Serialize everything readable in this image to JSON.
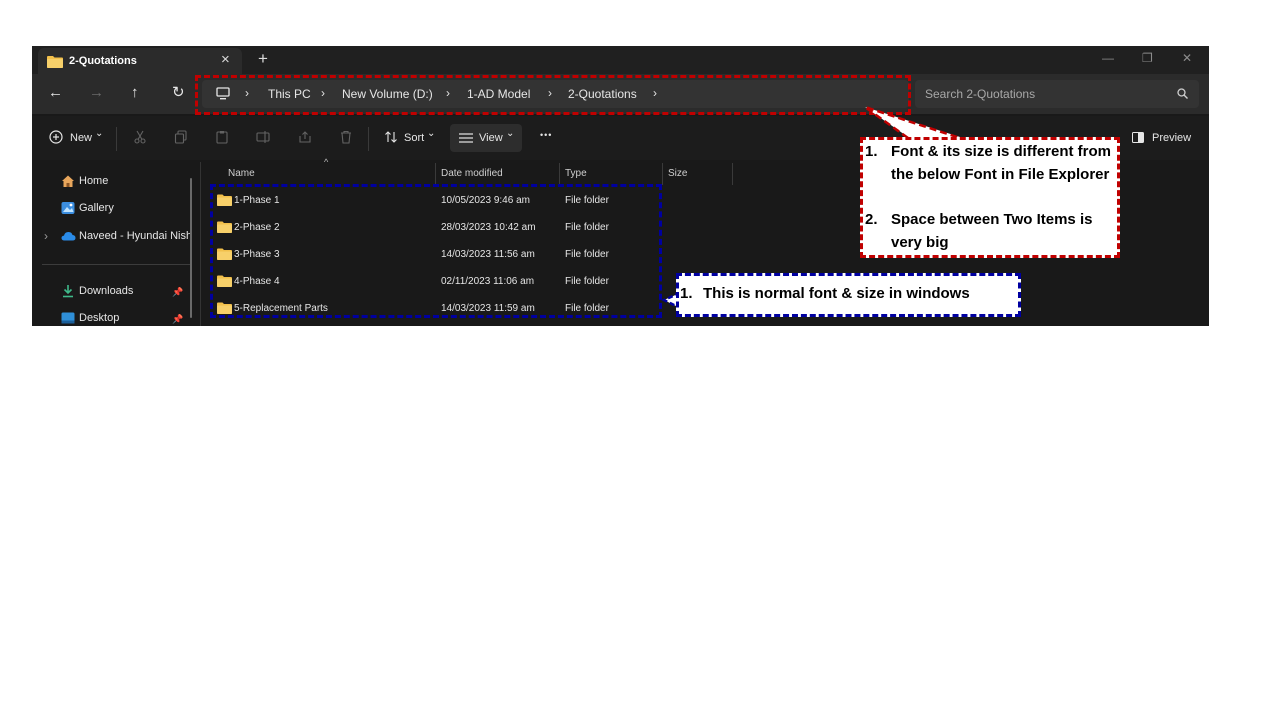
{
  "window": {
    "tab_title": "2-Quotations",
    "close_glyph": "×",
    "new_tab_glyph": "+",
    "minimize_glyph": "—",
    "maximize_glyph": "❐",
    "window_close_glyph": "✕"
  },
  "nav_buttons": {
    "back": "←",
    "forward": "→",
    "up": "↑",
    "refresh": "↻"
  },
  "address": {
    "crumbs": [
      "This PC",
      "New Volume (D:)",
      "1-AD Model",
      "2-Quotations"
    ],
    "separator": "›"
  },
  "search": {
    "placeholder": "Search 2-Quotations"
  },
  "commandbar": {
    "new_label": "New",
    "sort_label": "Sort",
    "view_label": "View",
    "more_label": "•••",
    "preview_label": "Preview",
    "dropdown_glyph": "⌄"
  },
  "nav_pane": {
    "items": [
      {
        "label": "Home"
      },
      {
        "label": "Gallery"
      },
      {
        "label": "Naveed - Hyundai Nish"
      },
      {
        "label": "Downloads"
      },
      {
        "label": "Desktop"
      }
    ],
    "expand_glyph": "›",
    "pin_glyph": "📌"
  },
  "file_list": {
    "columns": [
      "Name",
      "Date modified",
      "Type",
      "Size"
    ],
    "sort_caret": "^",
    "rows": [
      {
        "name": "1-Phase 1",
        "date": "10/05/2023 9:46 am",
        "type": "File folder"
      },
      {
        "name": "2-Phase 2",
        "date": "28/03/2023 10:42 am",
        "type": "File folder"
      },
      {
        "name": "3-Phase 3",
        "date": "14/03/2023 11:56 am",
        "type": "File folder"
      },
      {
        "name": "4-Phase 4",
        "date": "02/11/2023 11:06 am",
        "type": "File folder"
      },
      {
        "name": "5-Replacement Parts",
        "date": "14/03/2023 11:59 am",
        "type": "File folder"
      }
    ]
  },
  "annotations": {
    "red_callout": [
      {
        "num": "1.",
        "text": "Font & its size is different from the below Font in File Explorer"
      },
      {
        "num": "2.",
        "text": "Space between Two Items is very big"
      }
    ],
    "blue_callout": [
      {
        "num": "1.",
        "text": "This is normal font & size in windows"
      }
    ]
  },
  "colors": {
    "red_dash": "#c00000",
    "blue_dash": "#0000a0",
    "folder_yellow": "#f2c04b",
    "onedrive_blue": "#2a8be8"
  }
}
